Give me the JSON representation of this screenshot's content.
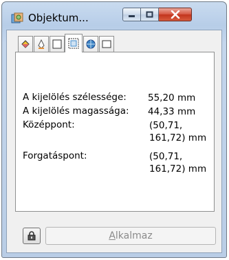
{
  "window": {
    "title": "Objektum..."
  },
  "tabs": [
    {
      "icon": "fill-bucket-icon"
    },
    {
      "icon": "pen-nib-icon"
    },
    {
      "icon": "frame-icon"
    },
    {
      "icon": "selection-frame-icon",
      "active": true
    },
    {
      "icon": "globe-icon"
    },
    {
      "icon": "blank-page-icon"
    }
  ],
  "properties": {
    "width": {
      "label": "A kijelölés szélessége:",
      "value": "55,20 mm"
    },
    "height": {
      "label": "A kijelölés magassága:",
      "value": "44,33 mm"
    },
    "center": {
      "label": "Középpont:",
      "value_line1": "(50,71,",
      "value_line2": "161,72) mm"
    },
    "rotation": {
      "label": "Forgatáspont:",
      "value_line1": "(50,71,",
      "value_line2": "161,72) mm"
    }
  },
  "footer": {
    "apply_accel": "A",
    "apply_rest": "lkalmaz"
  }
}
